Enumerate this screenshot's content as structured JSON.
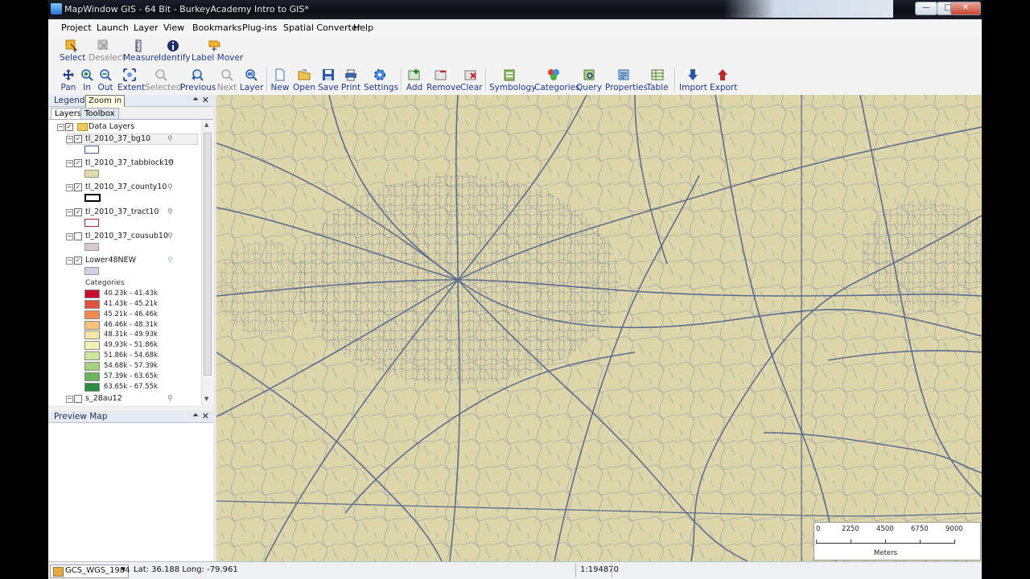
{
  "window": {
    "title": "MapWindow GIS - 64 Bit - BurkeyAcademy Intro to GIS*"
  },
  "menu": [
    "Project",
    "Launch",
    "Layer",
    "View",
    "Bookmarks",
    "Plug-ins",
    "Spatial Converter",
    "Help"
  ],
  "toolbar1": {
    "select": "Select",
    "deselect": "Deselect",
    "measure": "Measure",
    "identify": "Identify",
    "label_mover": "Label Mover"
  },
  "toolbar2": {
    "pan": "Pan",
    "in": "In",
    "out": "Out",
    "extent": "Extent",
    "selected": "Selected",
    "previous": "Previous",
    "next": "Next",
    "layer": "Layer",
    "new": "New",
    "open": "Open",
    "save": "Save",
    "print": "Print",
    "settings": "Settings",
    "add": "Add",
    "remove": "Remove",
    "clear": "Clear",
    "symbology": "Symbology",
    "categories": "Categories",
    "query": "Query",
    "properties": "Properties",
    "table": "Table",
    "import": "Import",
    "export": "Export"
  },
  "tooltip": "Zoom in",
  "legend": {
    "title": "Legend",
    "tabs": {
      "layers": "Layers",
      "toolbox": "Toolbox"
    },
    "group": "Data Layers",
    "layers": [
      {
        "name": "tl_2010_37_bg10",
        "checked": true,
        "swatch_fill": "#ffffff",
        "swatch_border": "#3f5f9a"
      },
      {
        "name": "tl_2010_37_tabblock10",
        "checked": true,
        "swatch_fill": "#dddcaa",
        "swatch_border": "#9a9a7a"
      },
      {
        "name": "tl_2010_37_county10",
        "checked": true,
        "swatch_fill": "#ffffff",
        "swatch_border": "#000000"
      },
      {
        "name": "tl_2010_37_tract10",
        "checked": true,
        "swatch_fill": "#ffffff",
        "swatch_border": "#a03030"
      },
      {
        "name": "tl_2010_37_cousub10",
        "checked": false,
        "swatch_fill": "#d6c9cc",
        "swatch_border": "#999999"
      },
      {
        "name": "Lower48NEW",
        "checked": true,
        "swatch_fill": "#cfd0e2",
        "swatch_border": "#999999"
      }
    ],
    "categories_label": "Categories",
    "categories": [
      {
        "label": "40.23k - 41.43k",
        "color": "#c8102e"
      },
      {
        "label": "41.43k - 45.21k",
        "color": "#e0533c"
      },
      {
        "label": "45.21k - 46.46k",
        "color": "#f28b52"
      },
      {
        "label": "46.46k - 48.31k",
        "color": "#f9c27a"
      },
      {
        "label": "48.31k - 49.93k",
        "color": "#fde6a6"
      },
      {
        "label": "49.93k - 51.86k",
        "color": "#f0f3b4"
      },
      {
        "label": "51.86k - 54.68k",
        "color": "#cfe6a0"
      },
      {
        "label": "54.68k - 57.39k",
        "color": "#a8d37c"
      },
      {
        "label": "57.39k - 63.65k",
        "color": "#6db35a"
      },
      {
        "label": "63.65k - 67.55k",
        "color": "#2c8a3e"
      }
    ],
    "last_layer": "s_28au12"
  },
  "preview": {
    "title": "Preview Map"
  },
  "map": {
    "background": "#ddd6aa",
    "scalebar": {
      "ticks": [
        "0",
        "2250",
        "4500",
        "6750",
        "9000"
      ],
      "unit": "Meters"
    }
  },
  "status": {
    "projection": "GCS_WGS_1984",
    "coords": "Lat: 36.188 Long: -79.961",
    "scale": "1:194870"
  }
}
